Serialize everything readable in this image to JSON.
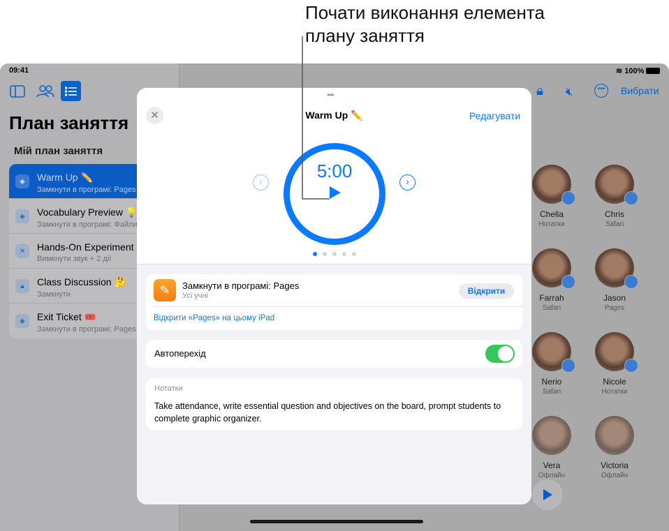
{
  "callout": {
    "line1": "Почати виконання елемента",
    "line2": "плану заняття"
  },
  "status_bar": {
    "time": "09:41",
    "battery": "100%"
  },
  "sidebar": {
    "title": "План заняття",
    "section": "Мій план заняття",
    "items": [
      {
        "title": "Warm Up ✏️",
        "subtitle": "Замкнути в програмі: Pages",
        "icon": "layers-icon",
        "selected": true
      },
      {
        "title": "Vocabulary Preview 💡",
        "subtitle": "Замкнути в програмі: Файли",
        "icon": "layers-icon"
      },
      {
        "title": "Hands-On Experiment",
        "subtitle": "Вимкнути звук + 2 дії",
        "icon": "mute-icon"
      },
      {
        "title": "Class Discussion 🤔",
        "subtitle": "Замкнути",
        "icon": "lock-icon"
      },
      {
        "title": "Exit Ticket 🎟️",
        "subtitle": "Замкнути в програмі: Pages",
        "icon": "layers-icon"
      }
    ]
  },
  "toolbar": {
    "select_label": "Вибрати"
  },
  "students": [
    {
      "name": "Chella",
      "status": "Нотатки"
    },
    {
      "name": "Chris",
      "status": "Safari"
    },
    {
      "name": "Farrah",
      "status": "Safari"
    },
    {
      "name": "Jason",
      "status": "Pages"
    },
    {
      "name": "Nerio",
      "status": "Safari"
    },
    {
      "name": "Nicole",
      "status": "Нотатки"
    },
    {
      "name": "Vera",
      "status": "Офлайн"
    },
    {
      "name": "Victoria",
      "status": "Офлайн"
    }
  ],
  "modal": {
    "title": "Warm Up ✏️",
    "edit_label": "Редагувати",
    "timer": "5:00",
    "page_count": 5,
    "current_page": 1,
    "app_card": {
      "title": "Замкнути в програмі: Pages",
      "subtitle": "Усі учні",
      "open_label": "Відкрити",
      "link": "Відкрити «Pages» на цьому iPad"
    },
    "auto_advance": {
      "label": "Автоперехід",
      "on": true
    },
    "notes": {
      "label": "Нотатки",
      "text": "Take attendance, write essential question and objectives on the board, prompt students to complete graphic organizer."
    }
  },
  "colors": {
    "accent": "#0a7aff",
    "toggle": "#34c759",
    "selected": "#0a5cc4"
  }
}
